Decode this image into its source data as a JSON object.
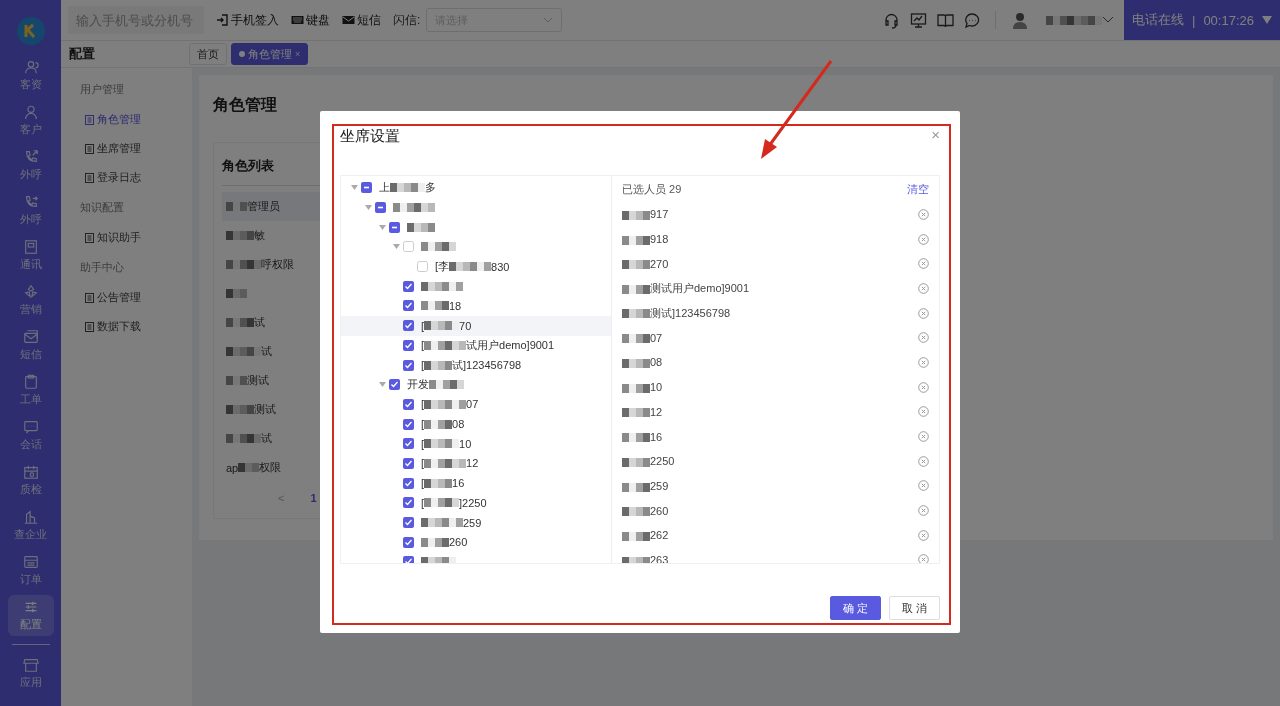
{
  "rail": {
    "items": [
      {
        "label": "客资",
        "selected": false
      },
      {
        "label": "客户",
        "selected": false
      },
      {
        "label": "外呼",
        "selected": false
      },
      {
        "label": "外呼",
        "selected": false
      },
      {
        "label": "通讯",
        "selected": false
      },
      {
        "label": "营销",
        "selected": false
      },
      {
        "label": "短信",
        "selected": false
      },
      {
        "label": "工单",
        "selected": false
      },
      {
        "label": "会话",
        "selected": false
      },
      {
        "label": "质检",
        "selected": false
      },
      {
        "label": "查企业",
        "selected": false
      },
      {
        "label": "订单",
        "selected": false
      },
      {
        "label": "配置",
        "selected": true
      }
    ],
    "bottom": {
      "label": "应用"
    }
  },
  "topbar": {
    "search": {
      "placeholder": "输入手机号或分机号"
    },
    "actions": [
      "手机签入",
      "键盘",
      "短信"
    ],
    "flash": {
      "label": "闪信:",
      "placeholder": "请选择"
    },
    "status": "电话在线",
    "status_sep": "|",
    "timer": "00:17:26"
  },
  "module_title": "配置",
  "tabs": [
    {
      "label": "首页",
      "selected": false
    },
    {
      "label": "角色管理",
      "selected": true,
      "close": "×"
    }
  ],
  "menu": [
    {
      "group": "用户管理",
      "items": [
        {
          "label": "角色管理",
          "selected": true
        },
        {
          "label": "坐席管理",
          "selected": false
        },
        {
          "label": "登录日志",
          "selected": false
        }
      ]
    },
    {
      "group": "知识配置",
      "items": [
        {
          "label": "知识助手",
          "selected": false
        }
      ]
    },
    {
      "group": "助手中心",
      "items": [
        {
          "label": "公告管理",
          "selected": false
        },
        {
          "label": "数据下载",
          "selected": false
        }
      ]
    }
  ],
  "page": {
    "title": "角色管理",
    "list_title": "角色列表",
    "roles": [
      {
        "label": "管理员",
        "selected": true
      },
      {
        "label": "敏",
        "selected": false
      },
      {
        "label": "呼权限",
        "selected": false
      },
      {
        "selected": false
      },
      {
        "label": "试",
        "selected": false
      },
      {
        "label": "试",
        "selected": false
      },
      {
        "label": "测试",
        "selected": false
      },
      {
        "label": "测试",
        "selected": false
      },
      {
        "label": "试",
        "selected": false
      },
      {
        "prefix": "ap",
        "label": "权限",
        "selected": false
      }
    ],
    "pagination": {
      "prev": "<",
      "pages": [
        {
          "label": "1",
          "selected": true
        }
      ]
    }
  },
  "dialog": {
    "title": "坐席设置",
    "close": "×",
    "tree": [
      {
        "prefix": "上",
        "label": "多",
        "checked": false,
        "indeterminate": true,
        "expanded": true,
        "children": [
          {
            "checked": false,
            "indeterminate": true,
            "expanded": true,
            "children": [
              {
                "checked": false,
                "indeterminate": true,
                "expanded": true,
                "children": [
                  {
                    "checked": false,
                    "expanded": true,
                    "children": [
                      {
                        "prefix": "[李",
                        "label": "830",
                        "checked": false
                      }
                    ]
                  },
                  {
                    "checked": true
                  },
                  {
                    "label": "18",
                    "checked": true
                  },
                  {
                    "prefix": "[",
                    "label": "70",
                    "checked": true,
                    "hovered": true
                  },
                  {
                    "prefix": "[",
                    "label": "试用户demo]9001",
                    "checked": true
                  },
                  {
                    "prefix": "[",
                    "label": "试]123456798",
                    "checked": true
                  }
                ]
              },
              {
                "prefix": "开发",
                "checked": true,
                "expanded": true,
                "children": [
                  {
                    "prefix": "[",
                    "label": "07",
                    "checked": true
                  },
                  {
                    "prefix": "[",
                    "label": "08",
                    "checked": true
                  },
                  {
                    "prefix": "[",
                    "label": "10",
                    "checked": true
                  },
                  {
                    "prefix": "[",
                    "label": "12",
                    "checked": true
                  },
                  {
                    "prefix": "[",
                    "label": "16",
                    "checked": true
                  },
                  {
                    "prefix": "[",
                    "label": "]2250",
                    "checked": true
                  },
                  {
                    "label": "259",
                    "checked": true
                  },
                  {
                    "label": "260",
                    "checked": true
                  },
                  {
                    "checked": true
                  }
                ]
              }
            ]
          }
        ]
      }
    ],
    "selected_title": "已选人员 29",
    "clear": "清空",
    "selected": [
      {
        "label": "917"
      },
      {
        "label": "918"
      },
      {
        "label": "270"
      },
      {
        "label": "测试用户demo]9001"
      },
      {
        "label": "测试]123456798"
      },
      {
        "label": "07"
      },
      {
        "label": "08"
      },
      {
        "label": "10"
      },
      {
        "label": "12"
      },
      {
        "label": "16"
      },
      {
        "label": "2250"
      },
      {
        "label": "259"
      },
      {
        "label": "260"
      },
      {
        "label": "262"
      },
      {
        "label": "263"
      }
    ],
    "buttons": [
      {
        "label": "确 定",
        "kind": "primary"
      },
      {
        "label": "取 消",
        "kind": "default"
      }
    ]
  }
}
